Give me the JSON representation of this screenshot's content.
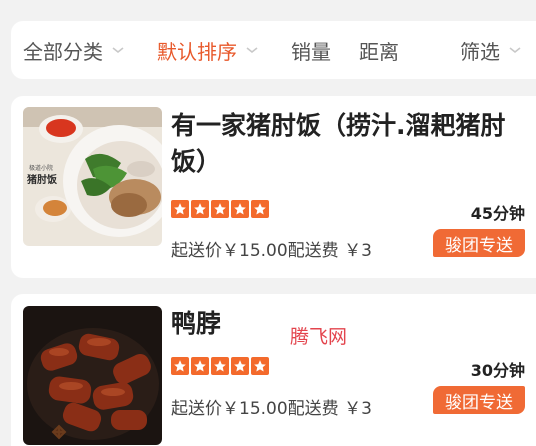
{
  "filters": {
    "items": [
      {
        "label": "全部分类",
        "has_chevron": true,
        "active": false
      },
      {
        "label": "默认排序",
        "has_chevron": true,
        "active": true
      },
      {
        "label": "销量",
        "has_chevron": false,
        "active": false
      },
      {
        "label": "距离",
        "has_chevron": false,
        "active": false
      },
      {
        "label": "筛选",
        "has_chevron": true,
        "active": false
      }
    ],
    "accent_color": "#e8592b"
  },
  "stores": [
    {
      "name": "有一家猪肘饭（捞汁.溜耙猪肘饭）",
      "rating_stars": 5,
      "eta": "45分钟",
      "fees": "起送价￥15.00配送费 ￥3",
      "badge": "骏团专送",
      "thumb_text_small": "极道小院",
      "thumb_text_main": "猪肘饭"
    },
    {
      "name": "鸭脖",
      "rating_stars": 5,
      "eta": "30分钟",
      "fees": "起送价￥15.00配送费 ￥3",
      "badge": "骏团专送"
    }
  ],
  "watermark": "腾飞网",
  "colors": {
    "badge": "#f06a35",
    "star": "#f36a2c"
  }
}
